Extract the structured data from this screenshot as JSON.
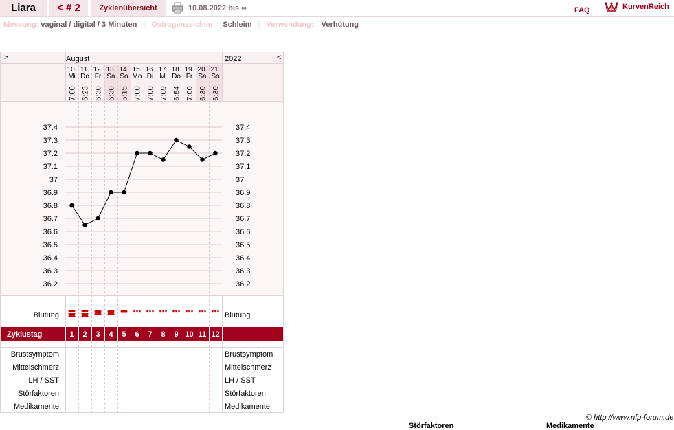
{
  "header": {
    "name": "Liara",
    "cycle": "< # 2",
    "overview": "Zyklenübersicht",
    "date_range": "10.08.2022 bis ∞",
    "faq": "FAQ",
    "logo_text": "KurvenReich"
  },
  "info": {
    "messung_label": "Messung:",
    "messung_value": "vaginal / digital / 3 Minuten",
    "oestrogen_label": "Östrogenzeichen:",
    "oestrogen_value": "Schleim",
    "verwendung_label": "Verwendung:",
    "verwendung_value": "Verhütung"
  },
  "chart": {
    "prev_arrow": ">",
    "next_arrow": "<",
    "month": "August",
    "year": "2022",
    "days": [
      {
        "date": "10.",
        "weekday": "Mi",
        "time": "7:00",
        "weekend": false
      },
      {
        "date": "11.",
        "weekday": "Do",
        "time": "6:23",
        "weekend": false
      },
      {
        "date": "12.",
        "weekday": "Fr",
        "time": "6:30",
        "weekend": false
      },
      {
        "date": "13.",
        "weekday": "Sa",
        "time": "6:30",
        "weekend": true
      },
      {
        "date": "14.",
        "weekday": "So",
        "time": "5:15",
        "weekend": true
      },
      {
        "date": "15.",
        "weekday": "Mo",
        "time": "7:00",
        "weekend": false
      },
      {
        "date": "16.",
        "weekday": "Di",
        "time": "7:00",
        "weekend": false
      },
      {
        "date": "17.",
        "weekday": "Mi",
        "time": "7:09",
        "weekend": false
      },
      {
        "date": "18.",
        "weekday": "Do",
        "time": "6:54",
        "weekend": false
      },
      {
        "date": "19.",
        "weekday": "Fr",
        "time": "7:00",
        "weekend": false
      },
      {
        "date": "20.",
        "weekday": "Sa",
        "time": "6:30",
        "weekend": true
      },
      {
        "date": "21.",
        "weekday": "So",
        "time": "6:30",
        "weekend": true
      }
    ],
    "temp_ticks": [
      "37.4",
      "37.3",
      "37.2",
      "37.1",
      "37",
      "36.9",
      "36.8",
      "36.7",
      "36.6",
      "36.5",
      "36.4",
      "36.3",
      "36.2"
    ],
    "bleeding": [
      "heavy",
      "heavy",
      "medium",
      "medium",
      "light",
      "spotting",
      "spotting",
      "spotting",
      "spotting",
      "spotting",
      "spotting",
      "spotting"
    ],
    "bleeding_label": "Blutung",
    "cycle_day_label": "Zyklustag",
    "cycle_days": [
      "1",
      "2",
      "3",
      "4",
      "5",
      "6",
      "7",
      "8",
      "9",
      "10",
      "11",
      "12"
    ],
    "rows": [
      "Brustsymptom",
      "Mittelschmerz",
      "LH / SST",
      "Störfaktoren",
      "Medikamente"
    ],
    "accent_color": "#a3001e",
    "bleeding_color": "#cc0000"
  },
  "chart_data": {
    "type": "line",
    "x": [
      "10.",
      "11.",
      "12.",
      "13.",
      "14.",
      "15.",
      "16.",
      "17.",
      "18.",
      "19.",
      "20.",
      "21."
    ],
    "values": [
      36.8,
      36.65,
      36.7,
      36.9,
      36.9,
      37.2,
      37.2,
      37.15,
      37.3,
      37.25,
      37.15,
      37.2
    ],
    "ylim": [
      36.2,
      37.4
    ],
    "grid": true
  },
  "footer": {
    "copyright": "© http://www.nfp-forum.de",
    "cut_stoer": "Störfaktoren",
    "cut_medi": "Medikamente"
  }
}
